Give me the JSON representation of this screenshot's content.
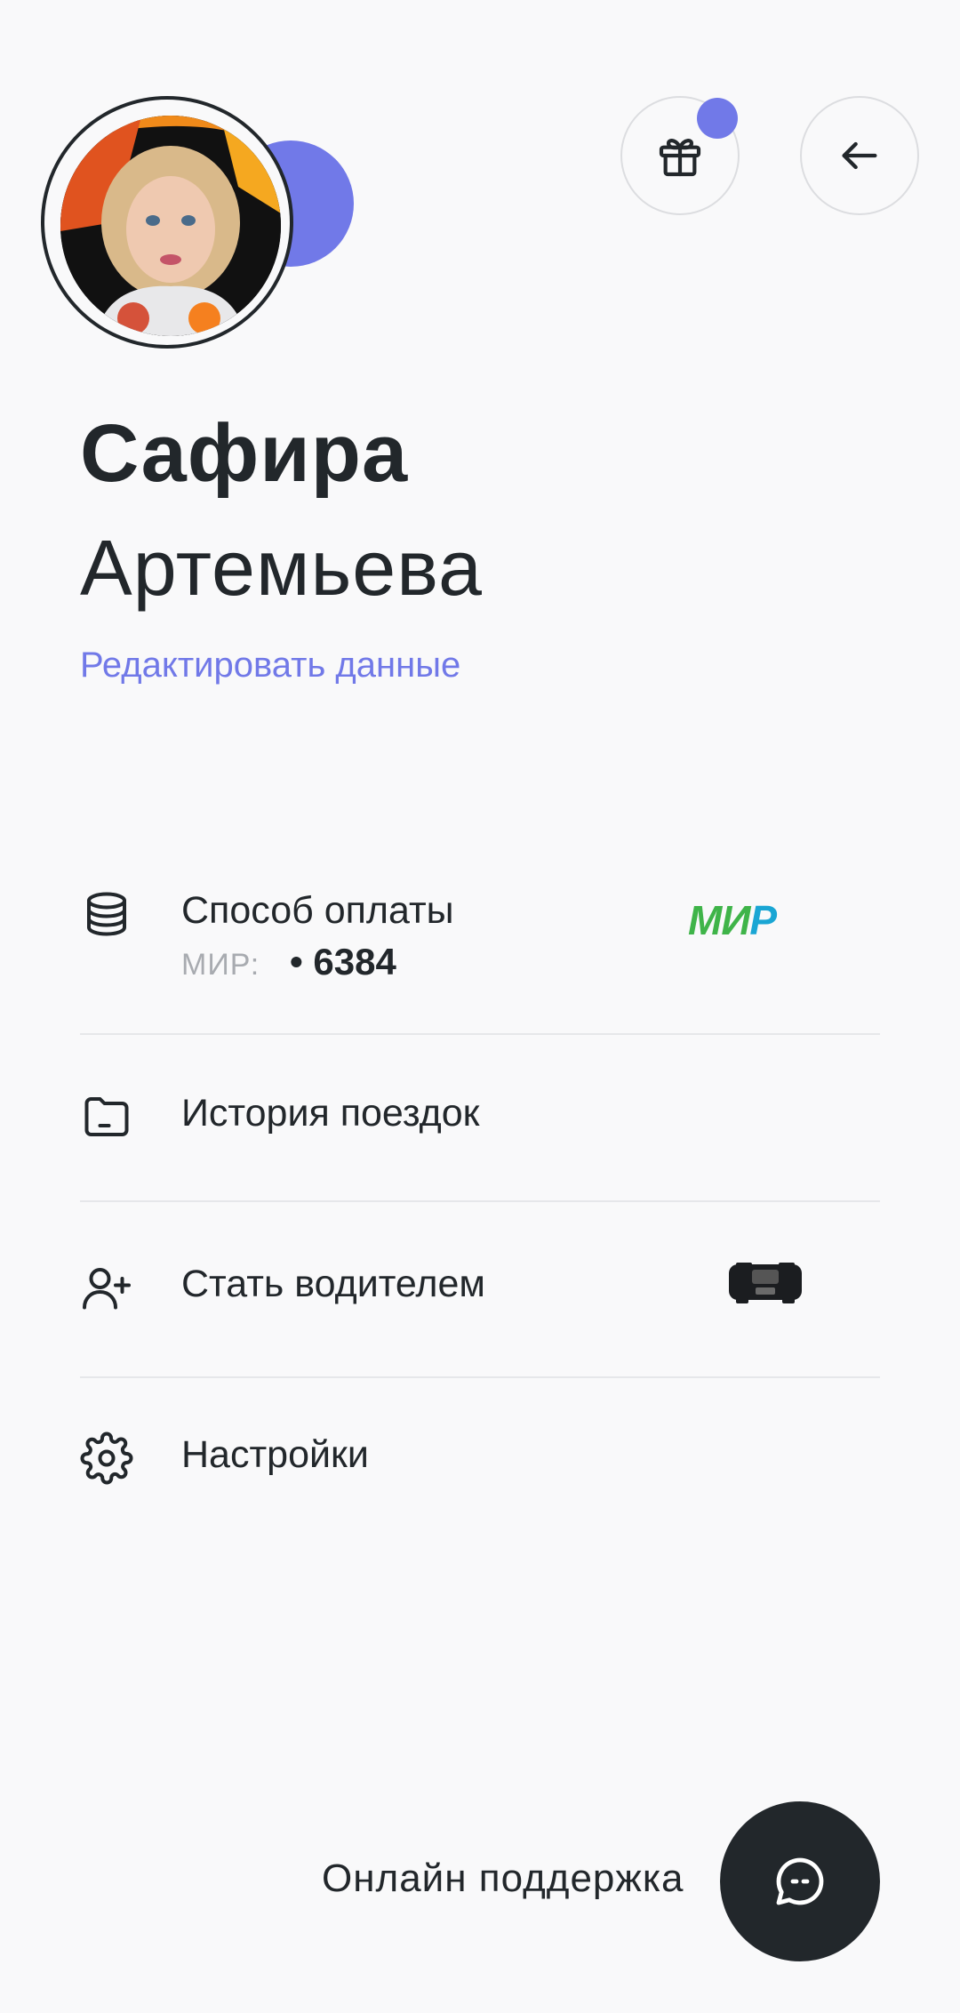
{
  "profile": {
    "first_name": "Сафира",
    "last_name": "Артемьева",
    "edit_label": "Редактировать данные"
  },
  "header": {
    "gift_icon": "gift-icon",
    "back_icon": "arrow-left-icon",
    "badge_color": "#7179e8"
  },
  "menu": {
    "payment": {
      "label": "Способ оплаты",
      "card_type": "МИР:",
      "card_number": "• 6384",
      "brand_logo": "МИР"
    },
    "history": {
      "label": "История поездок"
    },
    "driver": {
      "label": "Стать водителем"
    },
    "settings": {
      "label": "Настройки"
    }
  },
  "support": {
    "label": "Онлайн поддержка"
  },
  "colors": {
    "accent": "#7179e8",
    "text": "#22272b",
    "background": "#f9f9fa",
    "mir_green": "#3fb449",
    "mir_blue": "#1aa6d4"
  }
}
